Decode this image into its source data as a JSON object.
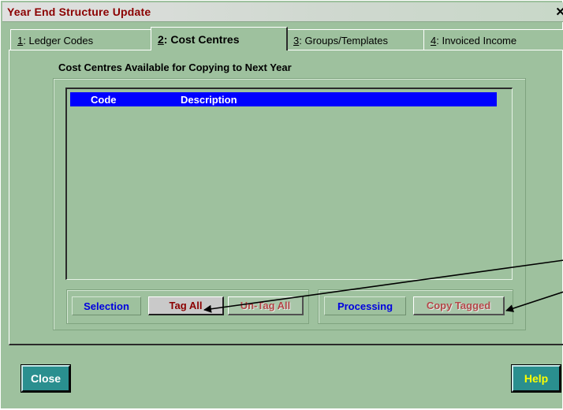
{
  "window": {
    "title": "Year End Structure Update",
    "close_glyph": "✕"
  },
  "tabs": [
    {
      "num": "1",
      "rest": ": Ledger Codes"
    },
    {
      "num": "2",
      "rest": ": Cost Centres"
    },
    {
      "num": "3",
      "rest": ": Groups/Templates"
    },
    {
      "num": "4",
      "rest": ": Invoiced Income"
    }
  ],
  "section_title": "Cost Centres Available for Copying to Next Year",
  "list": {
    "columns": [
      "Code",
      "Description"
    ],
    "rows": []
  },
  "selection": {
    "label": "Selection",
    "tag_all": "Tag All",
    "untag_all": "Un-Tag All"
  },
  "processing": {
    "label": "Processing",
    "copy_tagged": "Copy Tagged"
  },
  "footer": {
    "close": "Close",
    "help": "Help"
  },
  "colors": {
    "background": "#9ec19e",
    "title": "#8b0000",
    "header": "#0000ff",
    "label": "#0000e0",
    "button_teal": "#2a8f8f"
  }
}
